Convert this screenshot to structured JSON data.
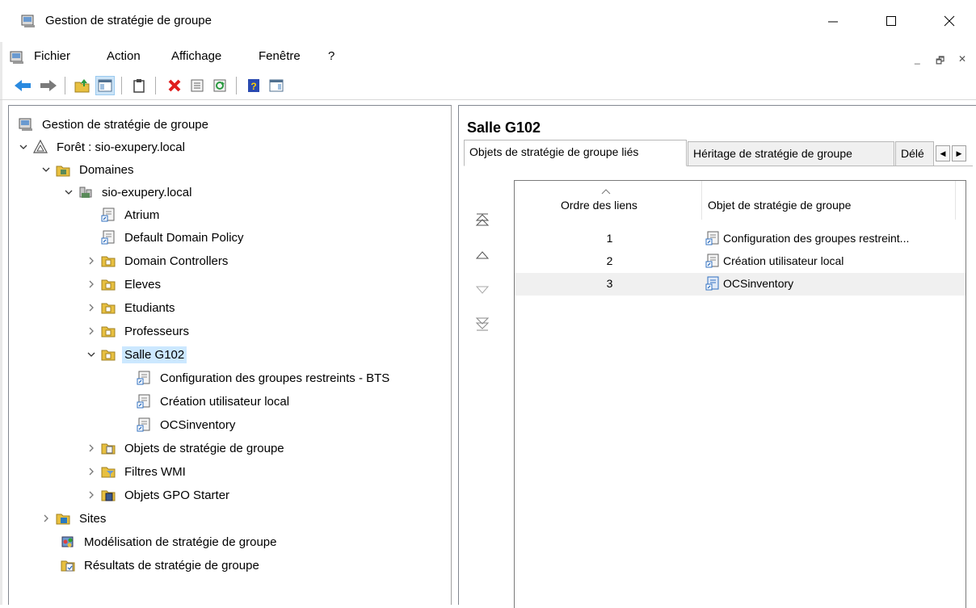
{
  "window": {
    "title": "Gestion de stratégie de groupe",
    "controls": {
      "minimize": "—",
      "maximize": "☐",
      "close": "✕"
    }
  },
  "menu": {
    "items": [
      "Fichier",
      "Action",
      "Affichage",
      "Fenêtre",
      "?"
    ],
    "mdi_controls": [
      "_",
      "🗗",
      "✕"
    ]
  },
  "toolbar": {
    "buttons": [
      "back-arrow-icon",
      "forward-arrow-icon",
      "up-folder-icon",
      "show-hide-tree-icon",
      "clipboard-icon",
      "delete-icon",
      "properties-icon",
      "refresh-icon",
      "help-icon",
      "action-pane-icon"
    ]
  },
  "tree": {
    "root": "Gestion de stratégie de groupe",
    "forest": "Forêt : sio-exupery.local",
    "domains": "Domaines",
    "domain": "sio-exupery.local",
    "gpo_links": [
      "Atrium",
      "Default Domain Policy"
    ],
    "ous": [
      "Domain Controllers",
      "Eleves",
      "Etudiants",
      "Professeurs"
    ],
    "selected_ou": "Salle G102",
    "selected_ou_children": [
      "Configuration des groupes restreints - BTS",
      "Création utilisateur local",
      "OCSinventory"
    ],
    "domain_containers": [
      "Objets de stratégie de groupe",
      "Filtres WMI",
      "Objets GPO Starter"
    ],
    "sites": "Sites",
    "modeling": "Modélisation de stratégie de groupe",
    "results": "Résultats de stratégie de groupe"
  },
  "details": {
    "title": "Salle G102",
    "tabs": [
      "Objets de stratégie de groupe liés",
      "Héritage de stratégie de groupe",
      "Délé"
    ],
    "active_tab": 0,
    "columns": [
      "Ordre des liens",
      "Objet de stratégie de groupe"
    ],
    "rows": [
      {
        "order": "1",
        "gpo": "Configuration des groupes restreint..."
      },
      {
        "order": "2",
        "gpo": "Création utilisateur local"
      },
      {
        "order": "3",
        "gpo": "OCSinventory"
      }
    ],
    "selected_row": 2,
    "move_buttons": [
      "move-to-top-icon",
      "move-up-icon",
      "move-down-icon",
      "move-to-bottom-icon"
    ]
  },
  "colors": {
    "selection": "#cce8ff",
    "row_selected": "#f0f0f0",
    "folder": "#e8c040",
    "gpo_blue": "#3070c0"
  }
}
